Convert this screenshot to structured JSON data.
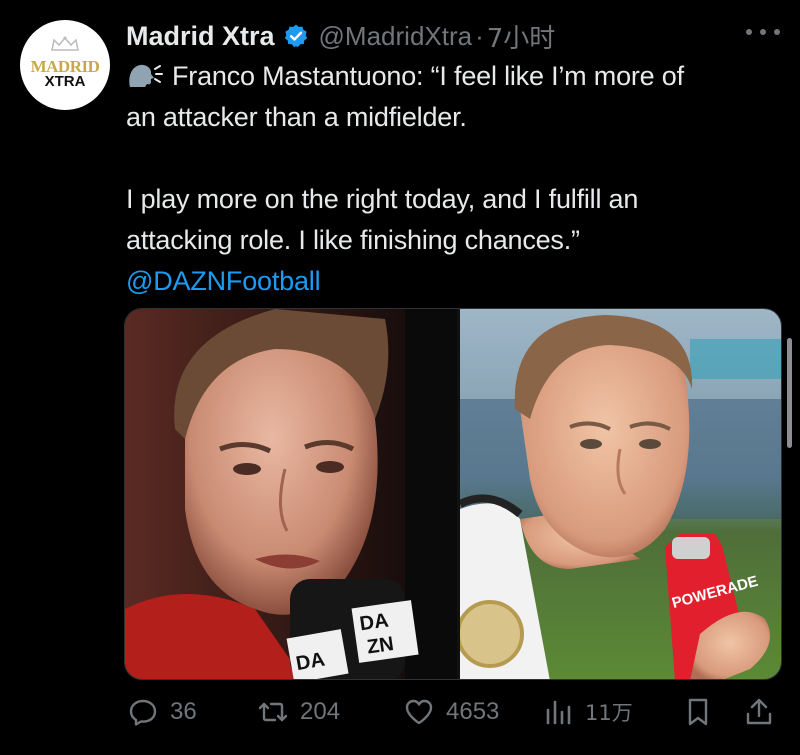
{
  "tweet": {
    "avatar_logo_top": "MADRID",
    "avatar_logo_bottom": "XTRA",
    "author_name": "Madrid Xtra",
    "handle": "@MadridXtra",
    "separator": "·",
    "time_ago": "7小时",
    "text_lines": [
      "Franco Mastantuono: “I feel like I’m more of",
      "an attacker than a midfielder.",
      "I play more on the right today, and I fulfill an",
      "attacking role. I like finishing chances.”"
    ],
    "mention": "@DAZNFootball",
    "leading_icon": "speaking-head-icon",
    "media": {
      "left_mic_text": "DA ZN",
      "bottle_text": "POWERADE"
    },
    "actions": {
      "replies": "36",
      "reposts": "204",
      "likes": "4653",
      "views": "11万"
    }
  },
  "colors": {
    "background": "#000000",
    "text_primary": "#e7e9ea",
    "text_secondary": "#71767b",
    "link": "#1d9bf0",
    "verified_badge": "#1d9bf0"
  },
  "icons": [
    "more-icon",
    "verified-badge-icon",
    "reply-icon",
    "repost-icon",
    "like-icon",
    "views-icon",
    "bookmark-icon",
    "share-icon"
  ]
}
